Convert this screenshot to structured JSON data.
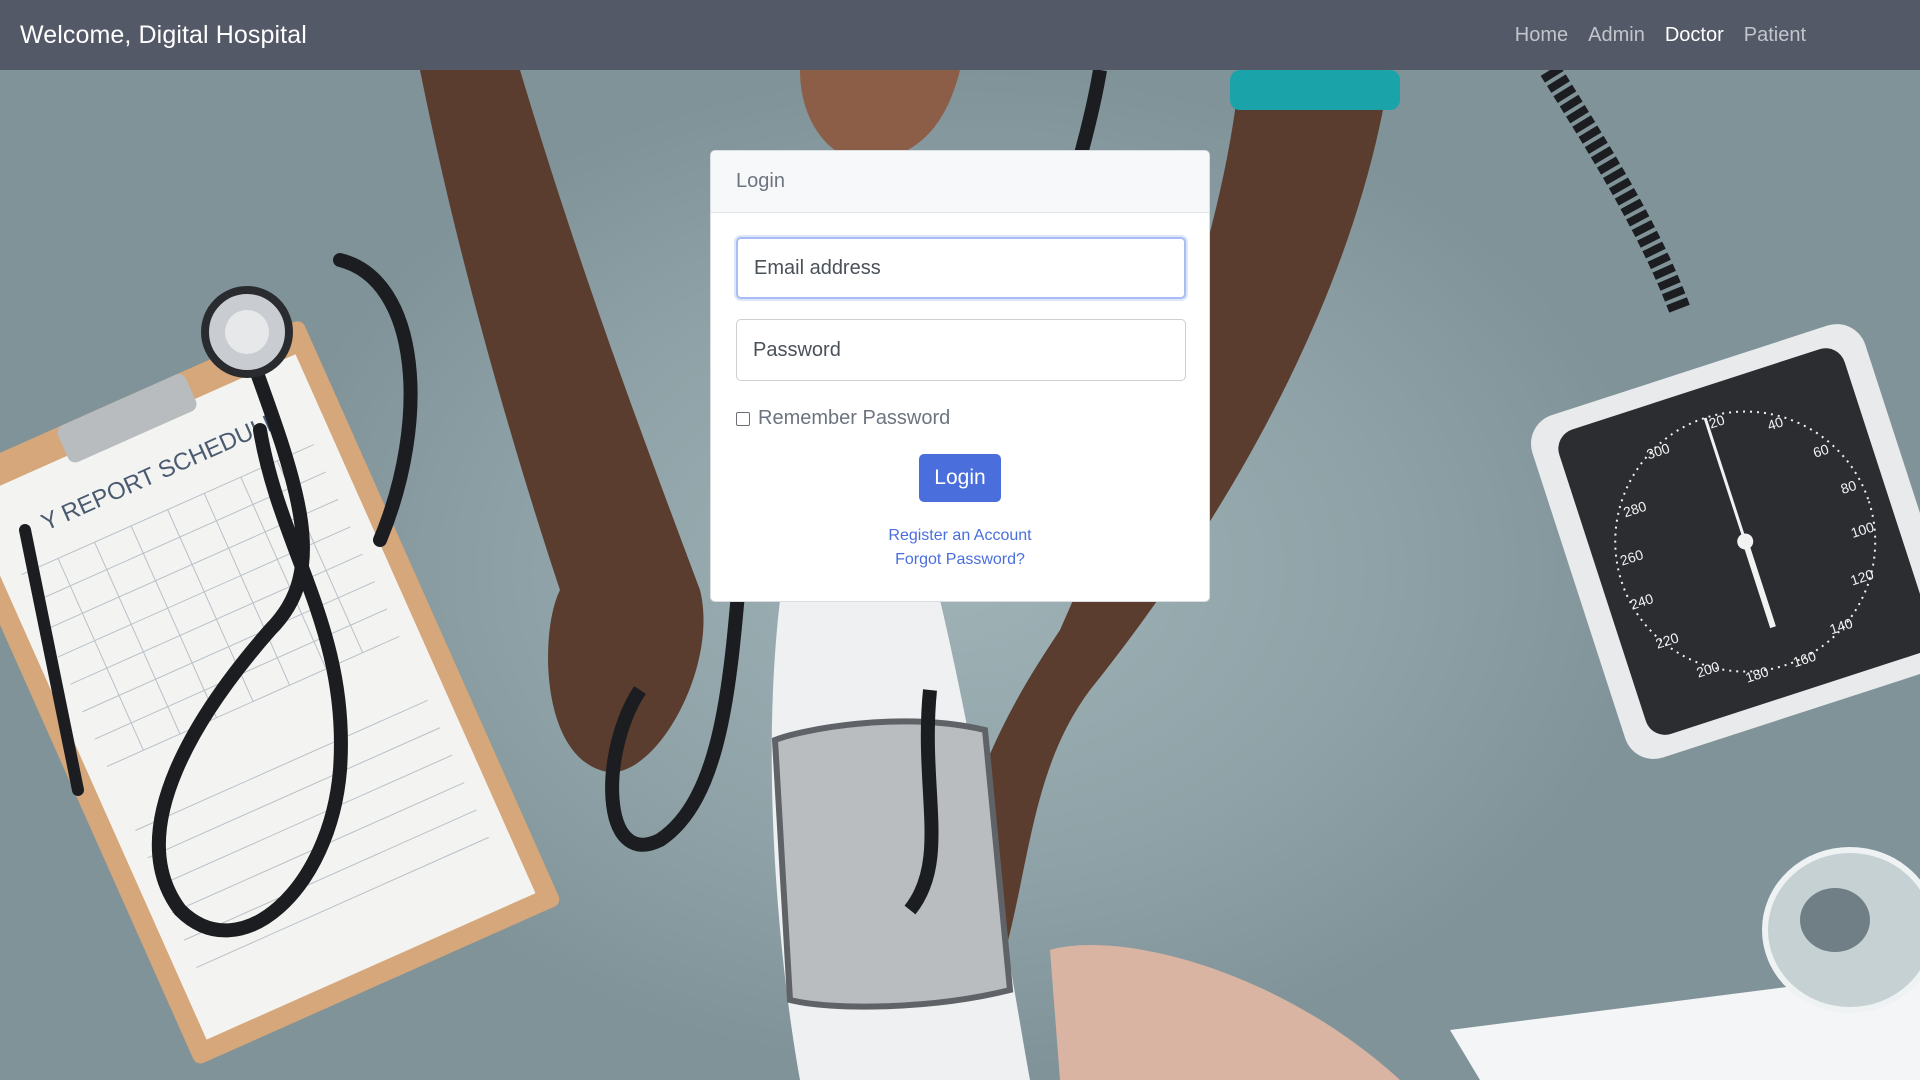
{
  "navbar": {
    "brand": "Welcome, Digital Hospital",
    "links": [
      {
        "label": "Home",
        "active": false
      },
      {
        "label": "Admin",
        "active": false
      },
      {
        "label": "Doctor",
        "active": true
      },
      {
        "label": "Patient",
        "active": false
      }
    ]
  },
  "login_card": {
    "header": "Login",
    "email_placeholder": "Email address",
    "password_placeholder": "Password",
    "remember_label": "Remember Password",
    "remember_checked": false,
    "submit_label": "Login",
    "register_link": "Register an Account",
    "forgot_link": "Forgot Password?"
  },
  "background": {
    "description_icon": "medical-photo-background",
    "clipboard_heading": "Y REPORT SCHEDULE",
    "gauge_labels": [
      "300",
      "20",
      "40",
      "60",
      "80",
      "100",
      "120",
      "140",
      "160",
      "180",
      "200",
      "220",
      "240",
      "260",
      "280"
    ]
  },
  "colors": {
    "navbar": "#545968",
    "accent": "#4a6fdc",
    "card_header": "#f7f8fa"
  }
}
